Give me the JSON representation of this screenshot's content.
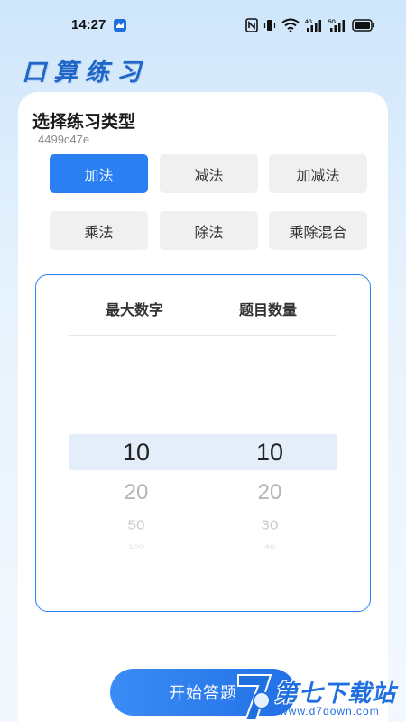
{
  "status_bar": {
    "time": "14:27",
    "icons": [
      "nfc-icon",
      "vibrate-icon",
      "wifi-icon",
      "signal-4g-icon",
      "signal-5g-icon",
      "battery-icon"
    ],
    "network_labels": [
      "4G",
      "5G"
    ]
  },
  "app": {
    "title": "口算练习"
  },
  "practice_type": {
    "title": "选择练习类型",
    "subtitle": "4499c47e",
    "options": [
      {
        "label": "加法",
        "selected": true
      },
      {
        "label": "减法",
        "selected": false
      },
      {
        "label": "加减法",
        "selected": false
      },
      {
        "label": "乘法",
        "selected": false
      },
      {
        "label": "除法",
        "selected": false
      },
      {
        "label": "乘除混合",
        "selected": false
      }
    ]
  },
  "picker": {
    "max_number": {
      "header": "最大数字",
      "options": [
        "10",
        "20",
        "50",
        "100"
      ],
      "selected": "10"
    },
    "question_count": {
      "header": "题目数量",
      "options": [
        "10",
        "20",
        "30",
        "40"
      ],
      "selected": "10"
    }
  },
  "start_button": {
    "label": "开始答题"
  },
  "watermark": {
    "brand": "第七下载站",
    "url": "www.d7down.com"
  },
  "colors": {
    "accent": "#2a7ff3",
    "title_blue": "#1f66c7",
    "highlight": "#e4eefb"
  }
}
